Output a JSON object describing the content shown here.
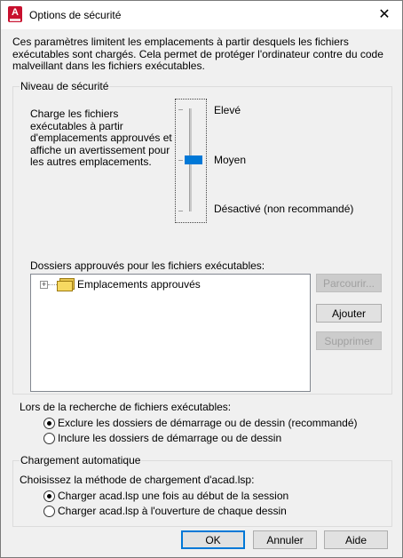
{
  "window": {
    "title": "Options de sécurité",
    "icon_letter": "A",
    "close_glyph": "✕"
  },
  "description": "Ces paramètres limitent les emplacements à partir desquels les fichiers exécutables sont chargés.  Cela permet de protéger l'ordinateur contre du code malveillant dans les fichiers exécutables.",
  "security_level": {
    "legend": "Niveau de sécurité",
    "text": "Charge les fichiers exécutables à partir d'emplacements approuvés et affiche un avertissement pour les autres emplacements.",
    "levels": [
      "Elevé",
      "Moyen",
      "Désactivé (non recommandé)"
    ],
    "selected_level": "Moyen"
  },
  "approved_folders": {
    "label": "Dossiers approuvés pour les fichiers exécutables:",
    "tree_item": "Emplacements approuvés",
    "browse_button": "Parcourir...",
    "add_button": "Ajouter",
    "delete_button": "Supprimer"
  },
  "search": {
    "label": "Lors de la recherche de fichiers exécutables:",
    "options": [
      "Exclure les dossiers de démarrage ou de dessin (recommandé)",
      "Inclure les dossiers de démarrage ou de dessin"
    ],
    "selected_index": 0
  },
  "autoload": {
    "legend": "Chargement automatique",
    "prompt": "Choisissez la méthode de chargement d'acad.lsp:",
    "options": [
      "Charger acad.lsp une fois au début de la session",
      "Charger acad.lsp à l'ouverture de chaque dessin"
    ],
    "selected_index": 0
  },
  "footer": {
    "ok": "OK",
    "cancel": "Annuler",
    "help": "Aide"
  },
  "colors": {
    "accent": "#0078d7",
    "app_icon": "#c8102e"
  }
}
